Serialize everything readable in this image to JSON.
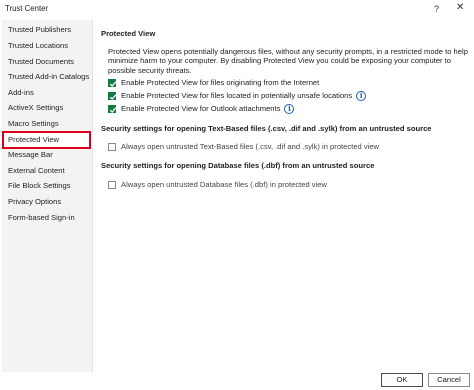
{
  "window": {
    "title": "Trust Center",
    "help_glyph": "?",
    "close_glyph": "✕"
  },
  "sidebar": {
    "items": [
      {
        "label": "Trusted Publishers"
      },
      {
        "label": "Trusted Locations"
      },
      {
        "label": "Trusted Documents"
      },
      {
        "label": "Trusted Add-in Catalogs"
      },
      {
        "label": "Add-ins"
      },
      {
        "label": "ActiveX Settings"
      },
      {
        "label": "Macro Settings"
      },
      {
        "label": "Protected View",
        "selected": true
      },
      {
        "label": "Message Bar"
      },
      {
        "label": "External Content"
      },
      {
        "label": "File Block Settings"
      },
      {
        "label": "Privacy Options"
      },
      {
        "label": "Form-based Sign-in"
      }
    ]
  },
  "protected_view": {
    "heading": "Protected View",
    "description": "Protected View opens potentially dangerous files, without any security prompts, in a restricted mode to help minimize harm to your computer. By disabling Protected View you could be exposing your computer to possible security threats.",
    "options": [
      {
        "label": "Enable Protected View for files originating from the Internet",
        "checked": true,
        "info": false
      },
      {
        "label": "Enable Protected View for files located in potentially unsafe locations",
        "checked": true,
        "info": true
      },
      {
        "label": "Enable Protected View for Outlook attachments",
        "checked": true,
        "info": true
      }
    ]
  },
  "text_based": {
    "heading": "Security settings for opening Text-Based files (.csv, .dif and .sylk) from an untrusted source",
    "option": {
      "label": "Always open untrusted Text-Based files (.csv, .dif and .sylk) in protected view",
      "checked": false
    }
  },
  "database": {
    "heading": "Security settings for opening Database files (.dbf) from an untrusted source",
    "option": {
      "label": "Always open untrusted Database files (.dbf) in protected view",
      "checked": false
    }
  },
  "footer": {
    "ok_label": "OK",
    "cancel_label": "Cancel"
  },
  "colors": {
    "accent_check": "#107c41",
    "selection_highlight": "#d9001b",
    "info": "#1a5fb4"
  }
}
